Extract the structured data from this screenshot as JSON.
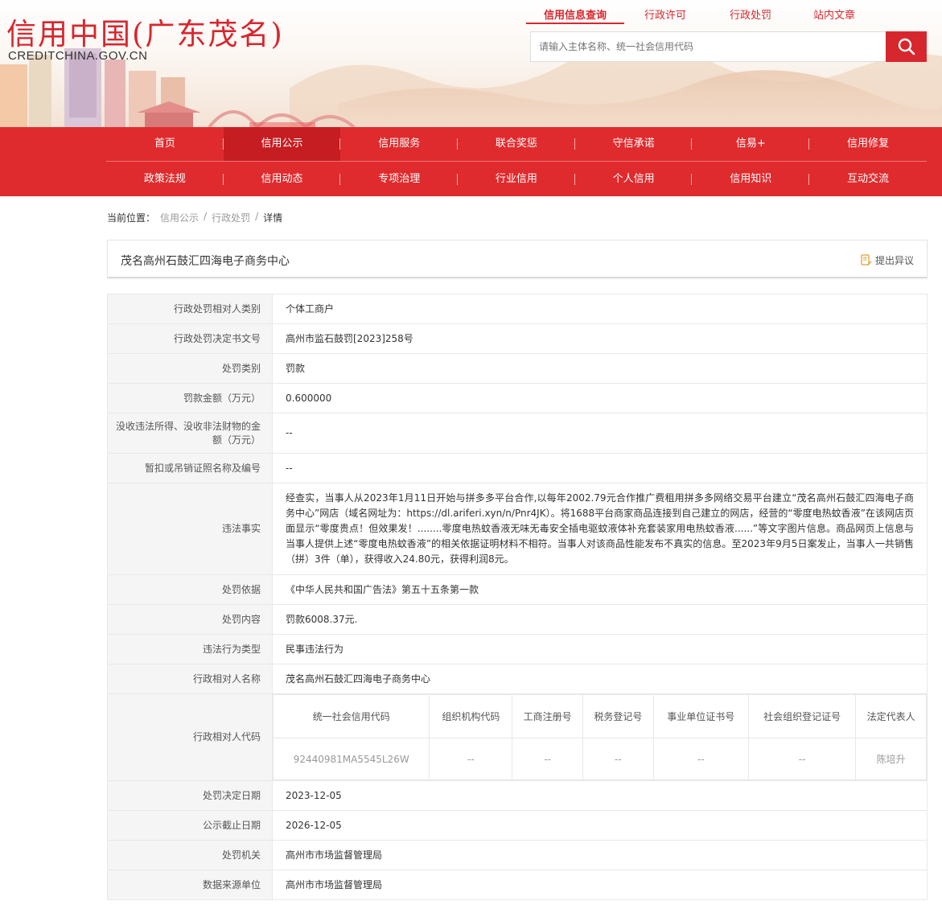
{
  "header": {
    "logo_cn": "信用中国(广东茂名)",
    "logo_en": "CREDITCHINA.GOV.CN",
    "top_tabs": [
      "信用信息查询",
      "行政许可",
      "行政处罚",
      "站内文章"
    ],
    "search_placeholder": "请输入主体名称、统一社会信用代码"
  },
  "nav": {
    "row1": [
      "首页",
      "信用公示",
      "信用服务",
      "联合奖惩",
      "守信承诺",
      "信易+",
      "信用修复"
    ],
    "row2": [
      "政策法规",
      "信用动态",
      "专项治理",
      "行业信用",
      "个人信用",
      "信用知识",
      "互动交流"
    ]
  },
  "breadcrumb": {
    "prefix": "当前位置：",
    "items": [
      "信用公示",
      "行政处罚",
      "详情"
    ]
  },
  "title": {
    "text": "茂名高州石鼓汇四海电子商务中心",
    "objection": "提出异议"
  },
  "details": {
    "r1": {
      "label": "行政处罚相对人类别",
      "value": "个体工商户"
    },
    "r2": {
      "label": "行政处罚决定书文号",
      "value": "高州市监石鼓罚[2023]258号"
    },
    "r3": {
      "label": "处罚类别",
      "value": "罚款"
    },
    "r4": {
      "label": "罚款金额（万元）",
      "value": "0.600000"
    },
    "r5": {
      "label": "没收违法所得、没收非法财物的金额（万元）",
      "value": "--"
    },
    "r6": {
      "label": "暂扣或吊销证照名称及编号",
      "value": "--"
    },
    "r7": {
      "label": "违法事实",
      "value": "经查实，当事人从2023年1月11日开始与拼多多平台合作,以每年2002.79元合作推广费租用拼多多网络交易平台建立“茂名高州石鼓汇四海电子商务中心”网店（域名网址为：https://dl.ariferi.xyn/n/Pnr4JK）。将1688平台商家商品连接到自己建立的网店，经营的“零度电热蚊香液”在该网店页面显示“零度贵点！但效果发！........零度电热蚊香液无味无毒安全插电驱蚊液体补充套装家用电热蚊香液......”等文字图片信息。商品网页上信息与当事人提供上述“零度电热蚊香液”的相关依据证明材料不相符。当事人对该商品性能发布不真实的信息。至2023年9月5日案发止，当事人一共销售（拼）3件（单），获得收入24.80元，获得利润8元。"
    },
    "r8": {
      "label": "处罚依据",
      "value": "《中华人民共和国广告法》第五十五条第一款"
    },
    "r9": {
      "label": "处罚内容",
      "value": "罚款6008.37元."
    },
    "r10": {
      "label": "违法行为类型",
      "value": "民事违法行为"
    },
    "r11": {
      "label": "行政相对人名称",
      "value": "茂名高州石鼓汇四海电子商务中心"
    },
    "r12": {
      "label": "行政相对人代码",
      "headers": [
        "统一社会信用代码",
        "组织机构代码",
        "工商注册号",
        "税务登记号",
        "事业单位证书号",
        "社会组织登记证号",
        "法定代表人"
      ],
      "values": [
        "92440981MA5545L26W",
        "--",
        "--",
        "--",
        "--",
        "--",
        "陈培升"
      ]
    },
    "r13": {
      "label": "处罚决定日期",
      "value": "2023-12-05"
    },
    "r14": {
      "label": "公示截止日期",
      "value": "2026-12-05"
    },
    "r15": {
      "label": "处罚机关",
      "value": "高州市市场监督管理局"
    },
    "r16": {
      "label": "数据来源单位",
      "value": "高州市市场监督管理局"
    }
  },
  "colors": {
    "brand_red": "#d7272e",
    "nav_red": "#df2b2e",
    "label_bg": "#f5f5f5"
  },
  "icons": {
    "search": "search-icon",
    "objection": "edit-document-icon"
  }
}
